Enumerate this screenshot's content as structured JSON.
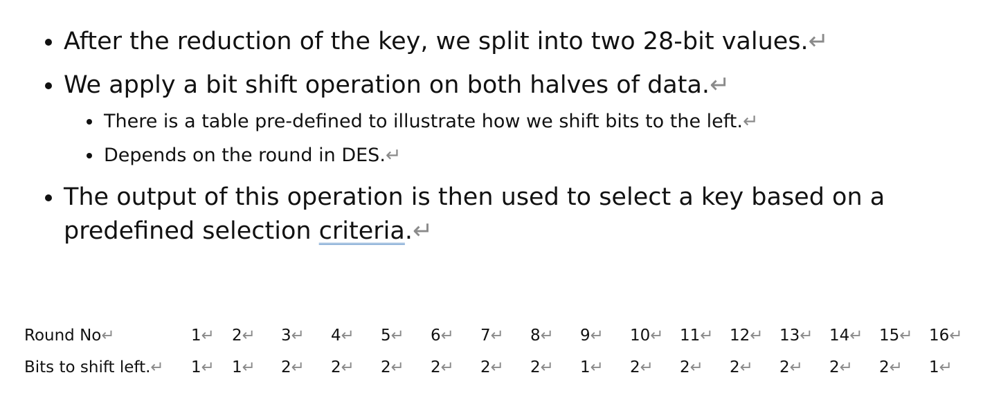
{
  "pilcrow": "↵",
  "bullets": [
    {
      "text": "After the reduction of the key, we split into two 28-bit values."
    },
    {
      "text": "We apply a bit shift operation on both halves of data."
    },
    {
      "text": "There is a table pre-defined to illustrate how we shift bits to the left."
    },
    {
      "text": "Depends on the round in DES."
    },
    {
      "line1": "The output of this operation is then used to select a key based on a",
      "line2_before": "predefined selection ",
      "line2_underlined": "criteria",
      "line2_after": "."
    }
  ],
  "shift_table": {
    "row_labels": [
      "Round No",
      "Bits to shift left."
    ],
    "rounds": [
      "1",
      "2",
      "3",
      "4",
      "5",
      "6",
      "7",
      "8",
      "9",
      "10",
      "11",
      "12",
      "13",
      "14",
      "15",
      "16"
    ],
    "shifts": [
      "1",
      "1",
      "2",
      "2",
      "2",
      "2",
      "2",
      "2",
      "1",
      "2",
      "2",
      "2",
      "2",
      "2",
      "2",
      "1"
    ]
  }
}
